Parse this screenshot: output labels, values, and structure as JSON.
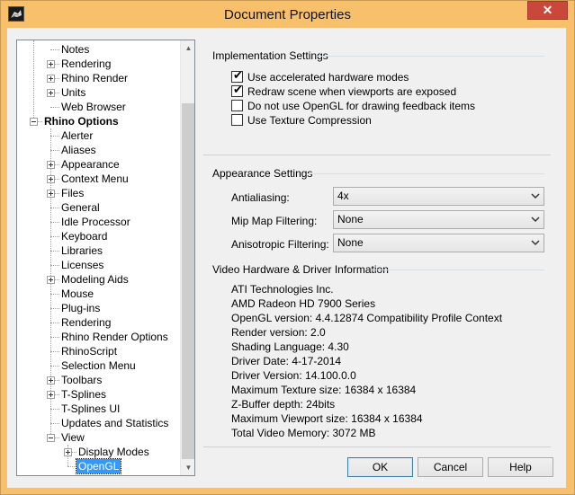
{
  "window": {
    "title": "Document Properties",
    "close_glyph": "✕",
    "app_icon": "rhino-app-icon"
  },
  "tree": {
    "items": [
      {
        "label": "Notes",
        "level": 1,
        "expander": "none"
      },
      {
        "label": "Rendering",
        "level": 1,
        "expander": "plus"
      },
      {
        "label": "Rhino Render",
        "level": 1,
        "expander": "plus"
      },
      {
        "label": "Units",
        "level": 1,
        "expander": "plus"
      },
      {
        "label": "Web Browser",
        "level": 1,
        "expander": "none"
      },
      {
        "label": "Rhino Options",
        "level": 0,
        "expander": "minus"
      },
      {
        "label": "Alerter",
        "level": 1,
        "expander": "none"
      },
      {
        "label": "Aliases",
        "level": 1,
        "expander": "none"
      },
      {
        "label": "Appearance",
        "level": 1,
        "expander": "plus"
      },
      {
        "label": "Context Menu",
        "level": 1,
        "expander": "plus"
      },
      {
        "label": "Files",
        "level": 1,
        "expander": "plus"
      },
      {
        "label": "General",
        "level": 1,
        "expander": "none"
      },
      {
        "label": "Idle Processor",
        "level": 1,
        "expander": "none"
      },
      {
        "label": "Keyboard",
        "level": 1,
        "expander": "none"
      },
      {
        "label": "Libraries",
        "level": 1,
        "expander": "none"
      },
      {
        "label": "Licenses",
        "level": 1,
        "expander": "none"
      },
      {
        "label": "Modeling Aids",
        "level": 1,
        "expander": "plus"
      },
      {
        "label": "Mouse",
        "level": 1,
        "expander": "none"
      },
      {
        "label": "Plug-ins",
        "level": 1,
        "expander": "none"
      },
      {
        "label": "Rendering",
        "level": 1,
        "expander": "none"
      },
      {
        "label": "Rhino Render Options",
        "level": 1,
        "expander": "none"
      },
      {
        "label": "RhinoScript",
        "level": 1,
        "expander": "none"
      },
      {
        "label": "Selection Menu",
        "level": 1,
        "expander": "none"
      },
      {
        "label": "Toolbars",
        "level": 1,
        "expander": "plus"
      },
      {
        "label": "T-Splines",
        "level": 1,
        "expander": "plus"
      },
      {
        "label": "T-Splines UI",
        "level": 1,
        "expander": "none"
      },
      {
        "label": "Updates and Statistics",
        "level": 1,
        "expander": "none"
      },
      {
        "label": "View",
        "level": 1,
        "expander": "minus"
      },
      {
        "label": "Display Modes",
        "level": 2,
        "expander": "plus"
      },
      {
        "label": "OpenGL",
        "level": 2,
        "expander": "none",
        "selected": true
      }
    ]
  },
  "implementation": {
    "title": "Implementation Settings",
    "options": [
      {
        "label": "Use accelerated hardware modes",
        "checked": true
      },
      {
        "label": "Redraw scene when viewports are exposed",
        "checked": true
      },
      {
        "label": "Do not use OpenGL for drawing feedback items",
        "checked": false
      },
      {
        "label": "Use Texture Compression",
        "checked": false
      }
    ],
    "check_glyph": "✔"
  },
  "appearance": {
    "title": "Appearance Settings",
    "fields": [
      {
        "label": "Antialiasing:",
        "value": "4x"
      },
      {
        "label": "Mip Map Filtering:",
        "value": "None"
      },
      {
        "label": "Anisotropic Filtering:",
        "value": "None"
      }
    ]
  },
  "video": {
    "title": "Video Hardware & Driver Information",
    "lines": [
      "ATI Technologies Inc.",
      "AMD Radeon HD 7900 Series",
      "OpenGL version: 4.4.12874 Compatibility Profile Context",
      "Render version: 2.0",
      "Shading Language: 4.30",
      "Driver Date: 4-17-2014",
      "Driver Version: 14.100.0.0",
      "Maximum Texture size: 16384 x 16384",
      "Z-Buffer depth: 24bits",
      "Maximum Viewport size: 16384 x 16384",
      "Total Video Memory: 3072 MB"
    ]
  },
  "buttons": {
    "ok": "OK",
    "cancel": "Cancel",
    "help": "Help"
  },
  "colors": {
    "titlebar": "#f8c06a",
    "close": "#c9483b",
    "selection": "#3399ff"
  }
}
